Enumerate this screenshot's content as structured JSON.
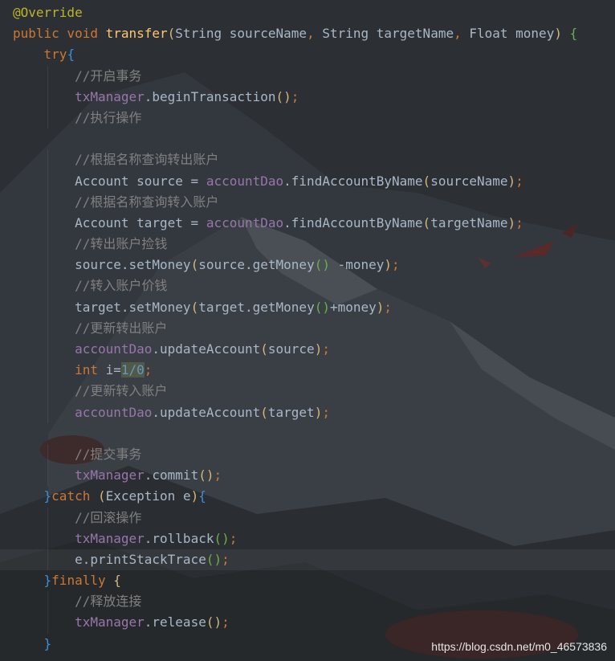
{
  "theme": {
    "background": "#2b2d30",
    "colors": {
      "annotation": "#bbb529",
      "keyword": "#cc7832",
      "method_decl": "#ffc66d",
      "plain": "#a9b7c6",
      "comment": "#808080",
      "field": "#9876aa",
      "number": "#6897bb",
      "brace": "#3d8fd8",
      "paren": "#d5b778",
      "call_paren": "#6ab04c"
    }
  },
  "editor": {
    "current_line_index": 26,
    "lines": [
      [
        {
          "t": "@Override",
          "c": "annotation"
        }
      ],
      [
        {
          "t": "public void ",
          "c": "keyword"
        },
        {
          "t": "transfer",
          "c": "method_decl"
        },
        {
          "t": "(",
          "c": "paren"
        },
        {
          "t": "String sourceName",
          "c": "plain"
        },
        {
          "t": ", ",
          "c": "keyword"
        },
        {
          "t": "String targetName",
          "c": "plain"
        },
        {
          "t": ", ",
          "c": "keyword"
        },
        {
          "t": "Float money",
          "c": "plain"
        },
        {
          "t": ") ",
          "c": "paren"
        },
        {
          "t": "{",
          "c": "call_paren"
        }
      ],
      [
        {
          "t": "    try",
          "c": "keyword"
        },
        {
          "t": "{",
          "c": "brace"
        }
      ],
      [
        {
          "t": "        //开启事务",
          "c": "comment"
        }
      ],
      [
        {
          "t": "        txManager",
          "c": "field"
        },
        {
          "t": ".beginTransaction",
          "c": "plain"
        },
        {
          "t": "()",
          "c": "paren"
        },
        {
          "t": ";",
          "c": "keyword"
        }
      ],
      [
        {
          "t": "        //执行操作",
          "c": "comment"
        }
      ],
      [
        {
          "t": "",
          "c": "plain"
        }
      ],
      [
        {
          "t": "        //根据名称查询转出账户",
          "c": "comment"
        }
      ],
      [
        {
          "t": "        Account source = ",
          "c": "plain"
        },
        {
          "t": "accountDao",
          "c": "field"
        },
        {
          "t": ".findAccountByName",
          "c": "plain"
        },
        {
          "t": "(",
          "c": "paren"
        },
        {
          "t": "sourceName",
          "c": "plain"
        },
        {
          "t": ")",
          "c": "paren"
        },
        {
          "t": ";",
          "c": "keyword"
        }
      ],
      [
        {
          "t": "        //根据名称查询转入账户",
          "c": "comment"
        }
      ],
      [
        {
          "t": "        Account target = ",
          "c": "plain"
        },
        {
          "t": "accountDao",
          "c": "field"
        },
        {
          "t": ".findAccountByName",
          "c": "plain"
        },
        {
          "t": "(",
          "c": "paren"
        },
        {
          "t": "targetName",
          "c": "plain"
        },
        {
          "t": ")",
          "c": "paren"
        },
        {
          "t": ";",
          "c": "keyword"
        }
      ],
      [
        {
          "t": "        //转出账户捡钱",
          "c": "comment"
        }
      ],
      [
        {
          "t": "        source.setMoney",
          "c": "plain"
        },
        {
          "t": "(",
          "c": "paren"
        },
        {
          "t": "source.getMoney",
          "c": "plain"
        },
        {
          "t": "()",
          "c": "call_paren"
        },
        {
          "t": " -money",
          "c": "plain"
        },
        {
          "t": ")",
          "c": "paren"
        },
        {
          "t": ";",
          "c": "keyword"
        }
      ],
      [
        {
          "t": "        //转入账户价钱",
          "c": "comment"
        }
      ],
      [
        {
          "t": "        target.setMoney",
          "c": "plain"
        },
        {
          "t": "(",
          "c": "paren"
        },
        {
          "t": "target.getMoney",
          "c": "plain"
        },
        {
          "t": "()",
          "c": "call_paren"
        },
        {
          "t": "+money",
          "c": "plain"
        },
        {
          "t": ")",
          "c": "paren"
        },
        {
          "t": ";",
          "c": "keyword"
        }
      ],
      [
        {
          "t": "        //更新转出账户",
          "c": "comment"
        }
      ],
      [
        {
          "t": "        accountDao",
          "c": "field"
        },
        {
          "t": ".updateAccount",
          "c": "plain"
        },
        {
          "t": "(",
          "c": "paren"
        },
        {
          "t": "source",
          "c": "plain"
        },
        {
          "t": ")",
          "c": "paren"
        },
        {
          "t": ";",
          "c": "keyword"
        }
      ],
      [
        {
          "t": "        int ",
          "c": "keyword"
        },
        {
          "t": "i",
          "c": "plain"
        },
        {
          "t": "=",
          "c": "plain"
        },
        {
          "t": "1/0",
          "c": "number_hl"
        },
        {
          "t": ";",
          "c": "keyword"
        }
      ],
      [
        {
          "t": "        //更新转入账户",
          "c": "comment"
        }
      ],
      [
        {
          "t": "        accountDao",
          "c": "field"
        },
        {
          "t": ".updateAccount",
          "c": "plain"
        },
        {
          "t": "(",
          "c": "paren"
        },
        {
          "t": "target",
          "c": "plain"
        },
        {
          "t": ")",
          "c": "paren"
        },
        {
          "t": ";",
          "c": "keyword"
        }
      ],
      [
        {
          "t": "",
          "c": "plain"
        }
      ],
      [
        {
          "t": "        //提交事务",
          "c": "comment"
        }
      ],
      [
        {
          "t": "        txManager",
          "c": "field"
        },
        {
          "t": ".commit",
          "c": "plain"
        },
        {
          "t": "()",
          "c": "paren"
        },
        {
          "t": ";",
          "c": "keyword"
        }
      ],
      [
        {
          "t": "    }",
          "c": "brace"
        },
        {
          "t": "catch ",
          "c": "keyword"
        },
        {
          "t": "(",
          "c": "paren"
        },
        {
          "t": "Exception e",
          "c": "plain"
        },
        {
          "t": ")",
          "c": "paren"
        },
        {
          "t": "{",
          "c": "brace"
        }
      ],
      [
        {
          "t": "        //回滚操作",
          "c": "comment"
        }
      ],
      [
        {
          "t": "        txManager",
          "c": "field"
        },
        {
          "t": ".rollback",
          "c": "plain"
        },
        {
          "t": "()",
          "c": "call_paren"
        },
        {
          "t": ";",
          "c": "keyword"
        }
      ],
      [
        {
          "t": "        e.printStackTrace",
          "c": "plain"
        },
        {
          "t": "()",
          "c": "call_paren"
        },
        {
          "t": ";",
          "c": "keyword"
        }
      ],
      [
        {
          "t": "    }",
          "c": "brace"
        },
        {
          "t": "finally ",
          "c": "keyword"
        },
        {
          "t": "{",
          "c": "paren"
        }
      ],
      [
        {
          "t": "        //释放连接",
          "c": "comment"
        }
      ],
      [
        {
          "t": "        txManager",
          "c": "field"
        },
        {
          "t": ".release",
          "c": "plain"
        },
        {
          "t": "()",
          "c": "paren"
        },
        {
          "t": ";",
          "c": "keyword"
        }
      ],
      [
        {
          "t": "    }",
          "c": "brace"
        }
      ]
    ]
  },
  "watermark": {
    "text": "https://blog.csdn.net/m0_46573836"
  }
}
